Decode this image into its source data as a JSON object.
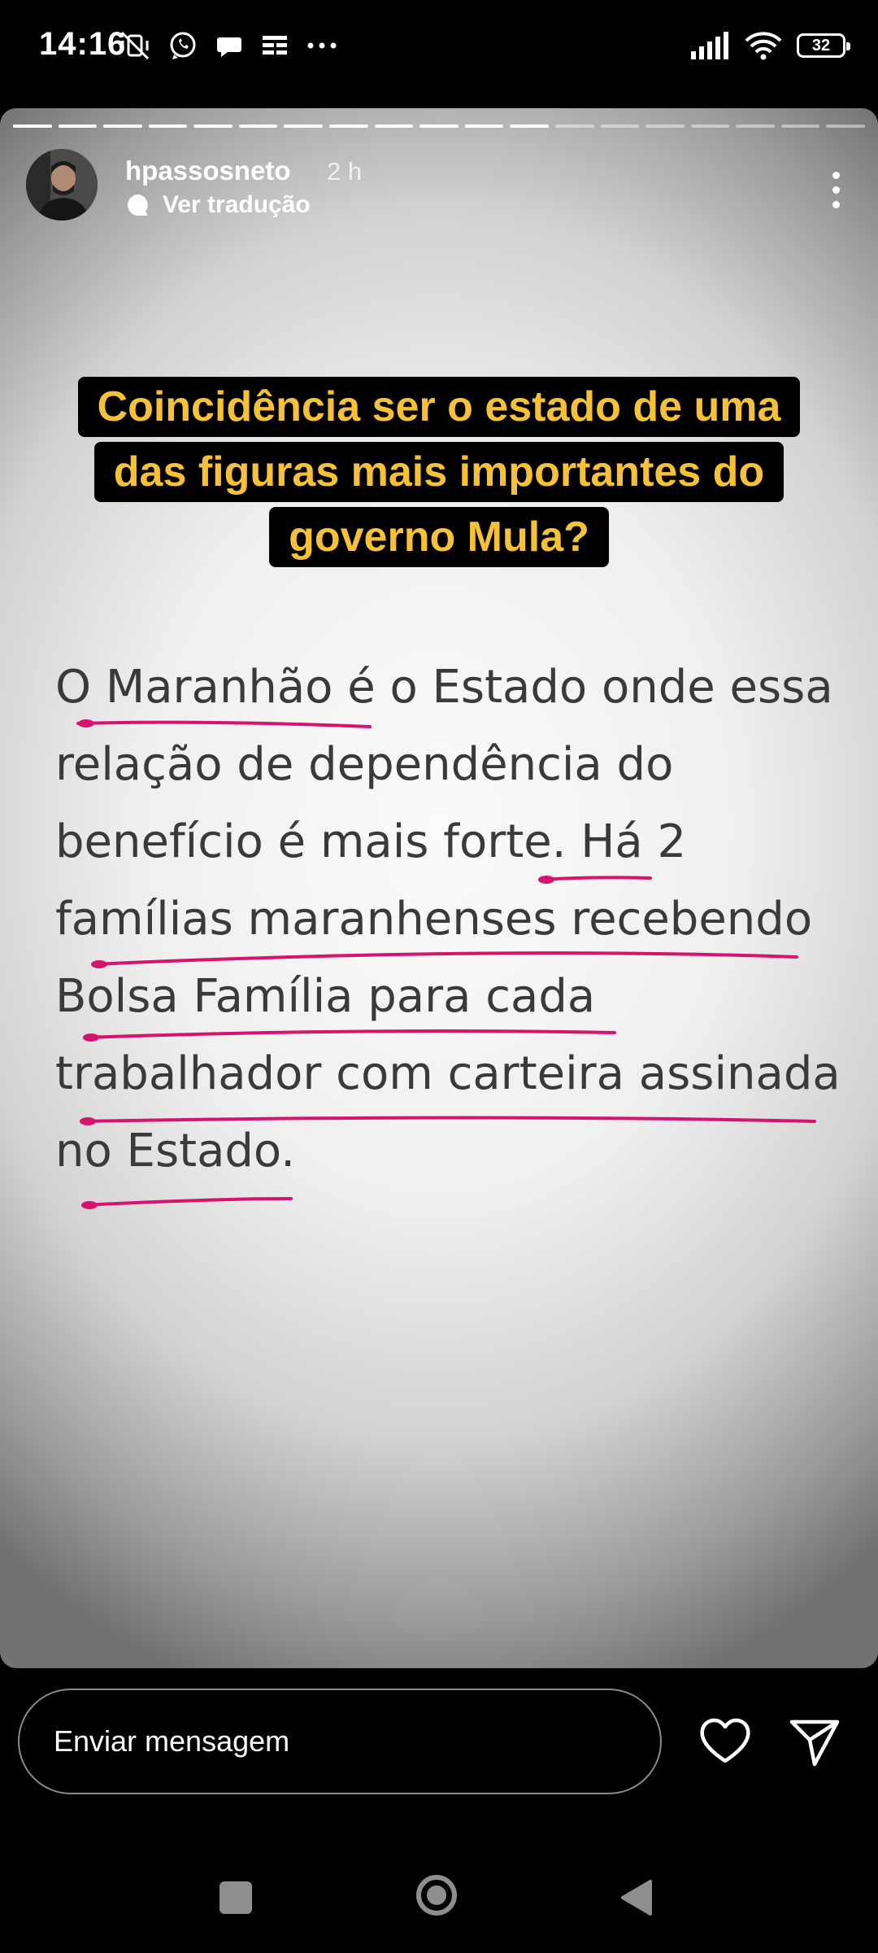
{
  "status_bar": {
    "time": "14:16",
    "left_icons": [
      "mute-vibrate-icon",
      "whatsapp-icon",
      "chat-bubble-icon",
      "notes-icon",
      "more-dots-icon"
    ],
    "right_icons": [
      "signal-icon",
      "wifi-icon",
      "battery-icon"
    ],
    "battery_level": "32"
  },
  "story": {
    "progress_segments_total": 19,
    "progress_segments_done": 12,
    "username": "hpassosneto",
    "time_ago": "2 h",
    "translate_label": "Ver tradução",
    "headline_lines": [
      "Coincidência ser o estado de uma",
      "das figuras mais importantes do",
      "governo Mula?"
    ],
    "headline_color": "#f6c137",
    "body_lines": [
      "O Maranhão é o Estado onde essa",
      "relação de dependência do",
      "benefício é mais forte. Há 2",
      "famílias maranhenses recebendo",
      "Bolsa Família para cada",
      "trabalhador com carteira assinada",
      "no Estado."
    ],
    "underline_color": "#d4146e"
  },
  "bottom_bar": {
    "message_placeholder": "Enviar mensagem"
  },
  "nav_bar": {
    "buttons": [
      "recent-apps",
      "home",
      "back"
    ]
  }
}
